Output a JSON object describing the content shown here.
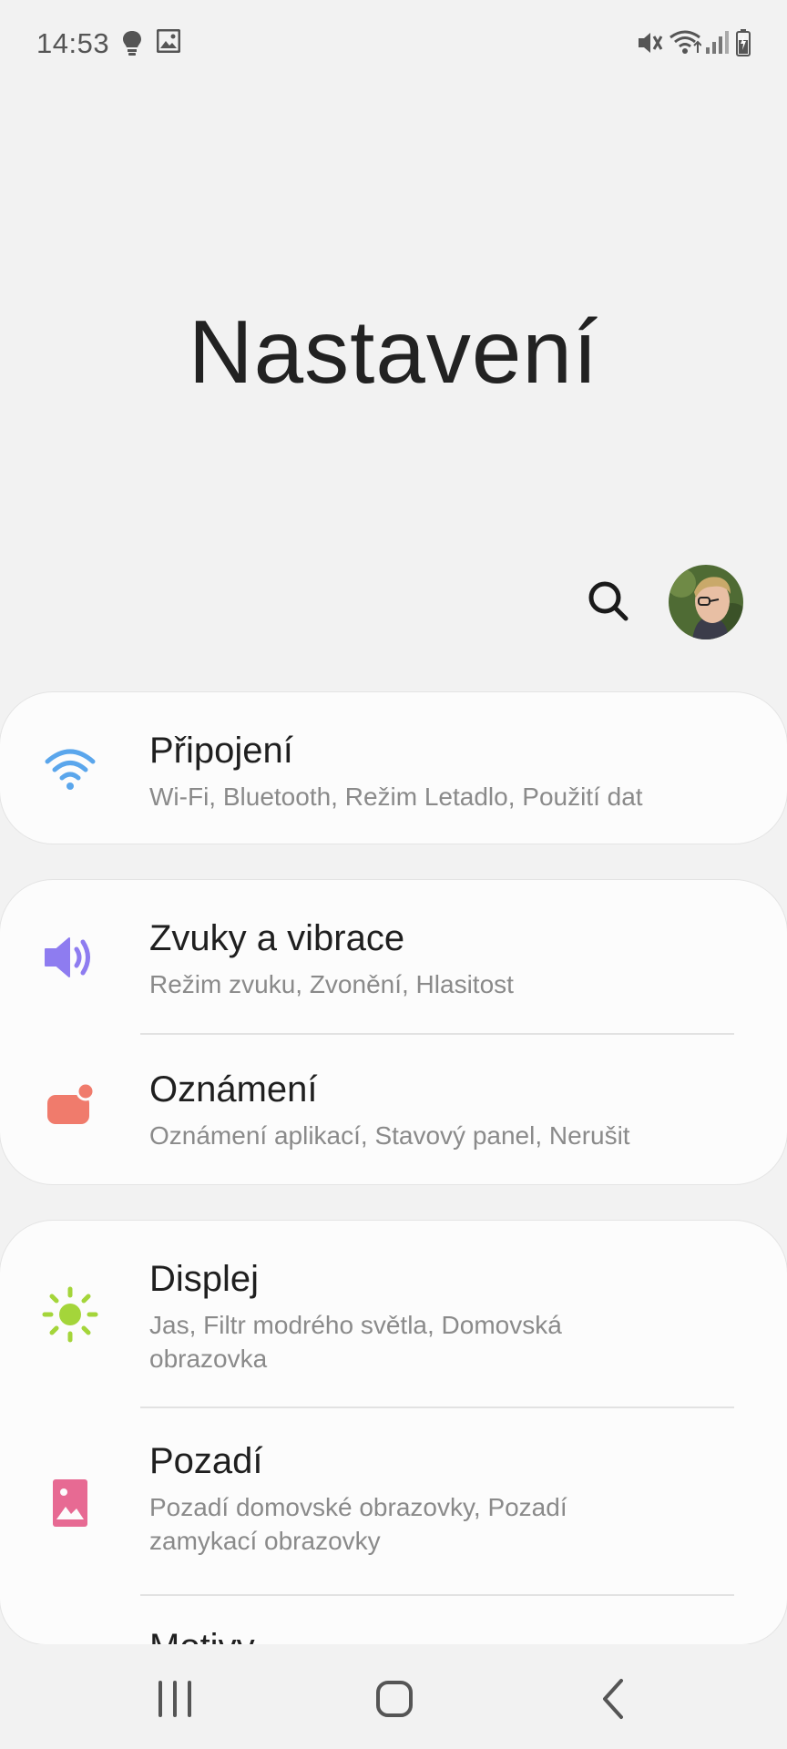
{
  "status_bar": {
    "time": "14:53",
    "left_icons": [
      "bulb-icon",
      "image-icon"
    ],
    "right_icons": [
      "mute-vibrate-icon",
      "wifi-icon",
      "signal-icon",
      "battery-icon"
    ]
  },
  "page": {
    "title": "Nastavení"
  },
  "header_actions": {
    "search_icon": "search-icon",
    "avatar": "profile-avatar"
  },
  "cards": [
    {
      "items": [
        {
          "title": "Připojení",
          "subtitle": "Wi-Fi, Bluetooth, Režim Letadlo, Použití dat",
          "icon": "wifi-icon",
          "color": "#5aa6ec"
        }
      ]
    },
    {
      "items": [
        {
          "title": "Zvuky a vibrace",
          "subtitle": "Režim zvuku, Zvonění, Hlasitost",
          "icon": "speaker-icon",
          "color": "#8e7cf0"
        },
        {
          "title": "Oznámení",
          "subtitle": "Oznámení aplikací, Stavový panel, Nerušit",
          "icon": "notification-icon",
          "color": "#f07b6c"
        }
      ]
    },
    {
      "items": [
        {
          "title": "Displej",
          "subtitle": "Jas, Filtr modrého světla, Domovská obrazovka",
          "icon": "sun-icon",
          "color": "#a4d53a"
        },
        {
          "title": "Pozadí",
          "subtitle": "Pozadí domovské obrazovky, Pozadí zamykací obrazovky",
          "icon": "wallpaper-icon",
          "color": "#e76a93"
        },
        {
          "title": "Motivy",
          "subtitle": "",
          "icon": "themes-icon",
          "color": "#b9a4e0"
        }
      ]
    }
  ],
  "nav_bar": {
    "buttons": [
      "recent-apps",
      "home",
      "back"
    ]
  }
}
